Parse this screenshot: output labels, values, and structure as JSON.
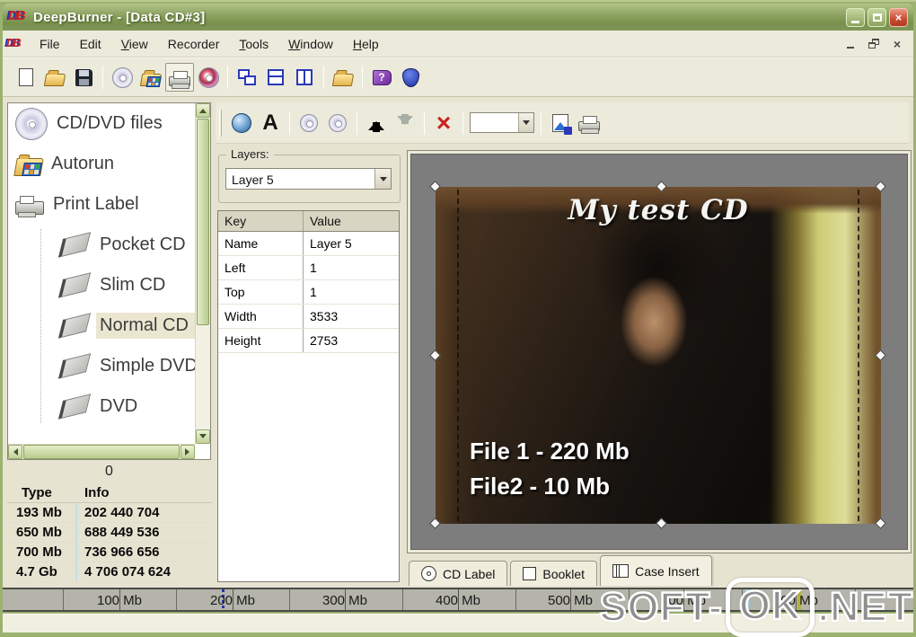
{
  "window": {
    "title": "DeepBurner  - [Data CD#3]"
  },
  "titlebar": {
    "logo_text": "DB",
    "controls": {
      "minimize": "",
      "maximize": "",
      "close": "×"
    }
  },
  "menubar": {
    "items": [
      "File",
      "Edit",
      "View",
      "Recorder",
      "Tools",
      "Window",
      "Help"
    ]
  },
  "toolbar_main": {
    "icons": [
      "new-document",
      "open-folder",
      "save",
      "cd-disc",
      "autorun",
      "print-label",
      "burn-disc",
      "cascade-windows",
      "tile-horizontal",
      "tile-vertical",
      "browse-folder",
      "help-book",
      "about-shield"
    ]
  },
  "toolbar_label": {
    "icons": [
      "insert-image",
      "insert-text",
      "disc-shape",
      "disc-text",
      "move-up",
      "move-down",
      "delete"
    ],
    "font_combo_value": "",
    "right_icons": [
      "export-image",
      "print"
    ]
  },
  "sidebar": {
    "items": [
      {
        "label": "CD/DVD files",
        "type": "root",
        "icon": "cd-disc"
      },
      {
        "label": "Autorun",
        "type": "root",
        "icon": "autorun-folder"
      },
      {
        "label": "Print Label",
        "type": "root",
        "icon": "printer"
      },
      {
        "label": "Pocket CD",
        "type": "child",
        "icon": "cd-case"
      },
      {
        "label": "Slim CD",
        "type": "child",
        "icon": "cd-case"
      },
      {
        "label": "Normal CD",
        "type": "child",
        "icon": "cd-case",
        "selected": true
      },
      {
        "label": "Simple DVD",
        "type": "child",
        "icon": "cd-case"
      },
      {
        "label": "DVD",
        "type": "child",
        "icon": "cd-case"
      }
    ]
  },
  "left_panel": {
    "counter": "0",
    "info_table": {
      "headers": [
        "Type",
        "Info"
      ],
      "rows": [
        [
          "193 Mb",
          "202 440 704"
        ],
        [
          "650 Mb",
          "688 449 536"
        ],
        [
          "700 Mb",
          "736 966 656"
        ],
        [
          "4.7 Gb",
          "4 706 074 624"
        ]
      ]
    }
  },
  "layers_panel": {
    "group_label": "Layers:",
    "selected_layer": "Layer 5",
    "table": {
      "headers": [
        "Key",
        "Value"
      ],
      "rows": [
        [
          "Name",
          "Layer 5"
        ],
        [
          "Left",
          "1"
        ],
        [
          "Top",
          "1"
        ],
        [
          "Width",
          "3533"
        ],
        [
          "Height",
          "2753"
        ]
      ]
    }
  },
  "preview": {
    "title_text": "My test CD",
    "file_lines": [
      "File 1 - 220 Mb",
      "File2 - 10 Mb"
    ]
  },
  "tabs": [
    {
      "label": "CD Label",
      "active": false
    },
    {
      "label": "Booklet",
      "active": false
    },
    {
      "label": "Case Insert",
      "active": true
    }
  ],
  "ruler": {
    "labels": [
      "100 Mb",
      "200 Mb",
      "300 Mb",
      "400 Mb",
      "500 Mb",
      "600 Mb",
      "700 Mb"
    ]
  },
  "watermark": {
    "part1": "SOFT-",
    "part2": "OK",
    "part3": ".NET"
  },
  "colors": {
    "titlebar_olive": "#8aa05e",
    "close_red": "#c84a30",
    "panel_cream": "#eceadb",
    "canvas_gray": "#7d7d7d",
    "marker_blue": "#2236aa",
    "marker_cyan": "#a6d8ea",
    "marker_olive": "#b2b244"
  }
}
